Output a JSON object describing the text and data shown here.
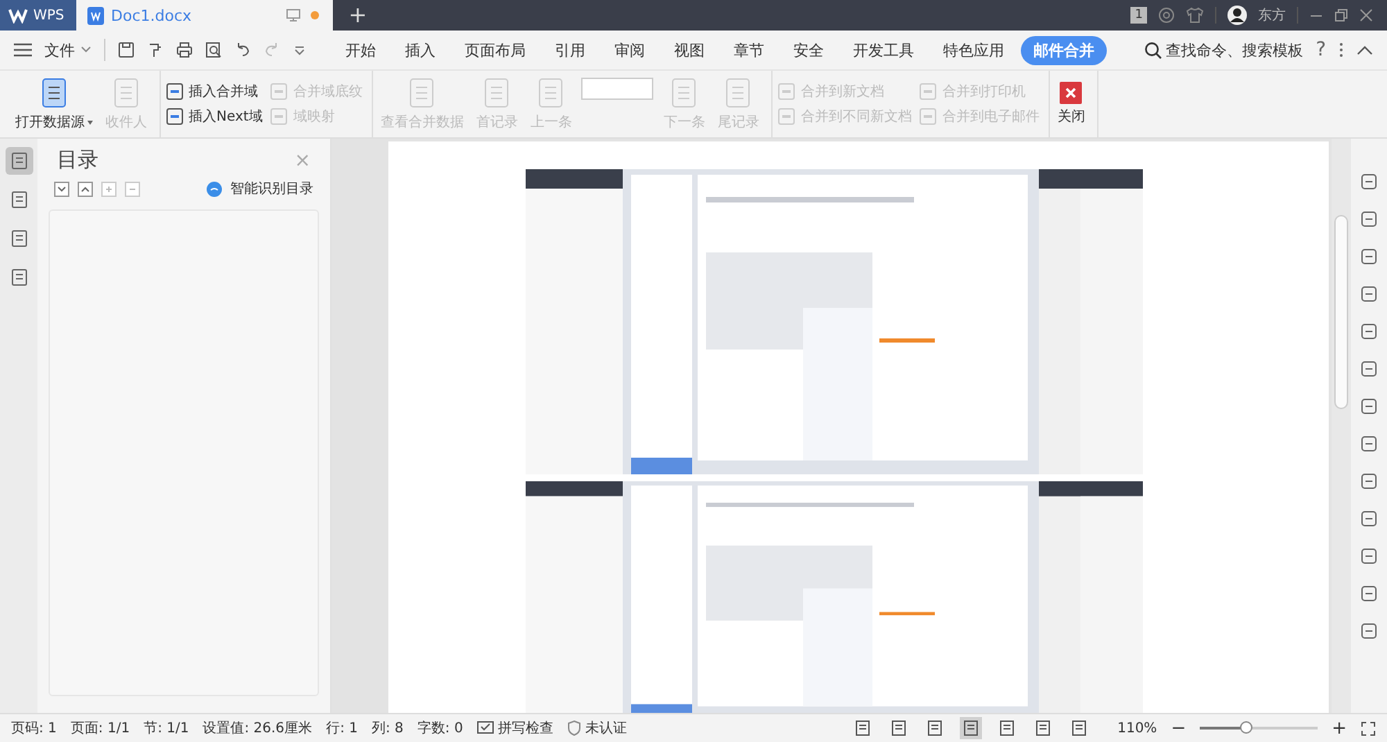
{
  "title_bar": {
    "app_tab": "WPS",
    "doc_tab": {
      "label": "Doc1.docx",
      "unsaved": true
    },
    "new_tab": "+",
    "badge": "1",
    "user": "东方"
  },
  "menu": {
    "file": "文件",
    "tabs": [
      {
        "label": "开始",
        "selected": false
      },
      {
        "label": "插入",
        "selected": false
      },
      {
        "label": "页面布局",
        "selected": false
      },
      {
        "label": "引用",
        "selected": false
      },
      {
        "label": "审阅",
        "selected": false
      },
      {
        "label": "视图",
        "selected": false
      },
      {
        "label": "章节",
        "selected": false
      },
      {
        "label": "安全",
        "selected": false
      },
      {
        "label": "开发工具",
        "selected": false
      },
      {
        "label": "特色应用",
        "selected": false
      },
      {
        "label": "邮件合并",
        "selected": true
      }
    ],
    "search": "查找命令、搜索模板",
    "help": "?"
  },
  "ribbon": {
    "groups": [
      {
        "items": [
          {
            "kind": "large",
            "label": "打开数据源",
            "disabled": false,
            "dropdown": true
          },
          {
            "kind": "large",
            "label": "收件人",
            "disabled": true,
            "dropdown": false
          }
        ]
      },
      {
        "items": [
          {
            "kind": "small",
            "label": "插入合并域",
            "disabled": false
          },
          {
            "kind": "small",
            "label": "插入Next域",
            "disabled": false
          },
          {
            "kind": "small",
            "label": "合并域底纹",
            "disabled": true
          },
          {
            "kind": "small",
            "label": "域映射",
            "disabled": true
          }
        ]
      },
      {
        "items": [
          {
            "kind": "large",
            "label": "查看合并数据",
            "disabled": true,
            "dropdown": false
          },
          {
            "kind": "large",
            "label": "首记录",
            "disabled": true,
            "dropdown": false
          },
          {
            "kind": "large",
            "label": "上一条",
            "disabled": true,
            "dropdown": false
          },
          {
            "kind": "field"
          },
          {
            "kind": "large",
            "label": "下一条",
            "disabled": true,
            "dropdown": false
          },
          {
            "kind": "large",
            "label": "尾记录",
            "disabled": true,
            "dropdown": false
          }
        ]
      },
      {
        "items": [
          {
            "kind": "small",
            "label": "合并到新文档",
            "disabled": true
          },
          {
            "kind": "small",
            "label": "合并到不同新文档",
            "disabled": true
          },
          {
            "kind": "small",
            "label": "合并到打印机",
            "disabled": true
          },
          {
            "kind": "small",
            "label": "合并到电子邮件",
            "disabled": true
          }
        ]
      },
      {
        "items": [
          {
            "kind": "close",
            "label": "关闭",
            "disabled": false
          }
        ]
      }
    ]
  },
  "nav_panel": {
    "title": "目录",
    "close": "×",
    "smart_toc": "智能识别目录",
    "side_icons": [
      {
        "selected": true
      },
      {
        "selected": false
      },
      {
        "selected": false
      },
      {
        "selected": false
      }
    ]
  },
  "status_bar": {
    "items": [
      "页码: 1",
      "页面: 1/1",
      "节: 1/1",
      "设置值: 26.6厘米",
      "行: 1",
      "列: 8",
      "字数: 0"
    ],
    "spell_check": "拼写检查",
    "auth": "未认证",
    "view_buttons": [
      {
        "selected": false
      },
      {
        "selected": false
      },
      {
        "selected": false
      },
      {
        "selected": true
      },
      {
        "selected": false
      },
      {
        "selected": false
      },
      {
        "selected": false
      }
    ],
    "zoom": "110%",
    "zoom_slider": {
      "level": 0.4
    },
    "zoom_out": "−",
    "zoom_in": "+"
  }
}
